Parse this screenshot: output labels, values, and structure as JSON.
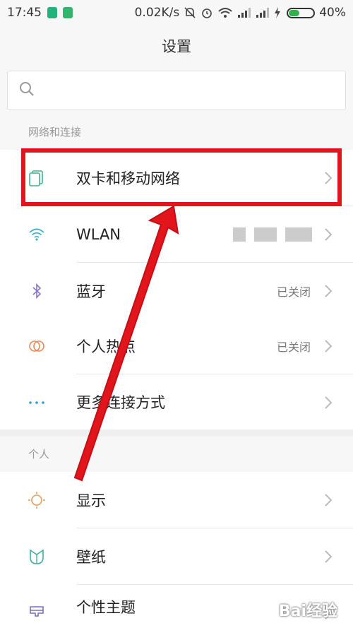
{
  "status_bar": {
    "time": "17:45",
    "network_speed": "0.02K/s",
    "battery_percent": "40%",
    "battery_level": 0.4,
    "icons": [
      "shield-badge-icon",
      "sim-badge-icon",
      "bell-muted-icon",
      "alarm-icon",
      "wifi-icon",
      "signal-1-icon",
      "signal-2-icon",
      "charging-icon",
      "battery-icon"
    ]
  },
  "header": {
    "title": "设置"
  },
  "search": {
    "icon": "search-icon",
    "placeholder": ""
  },
  "sections": {
    "network": {
      "title": "网络和连接"
    },
    "personal": {
      "title": "个人"
    }
  },
  "rows": {
    "dual_sim": {
      "label": "双卡和移动网络",
      "icon": "dual-sim-icon"
    },
    "wlan": {
      "label": "WLAN",
      "icon": "wifi-icon"
    },
    "bluetooth": {
      "label": "蓝牙",
      "status": "已关闭",
      "icon": "bluetooth-icon"
    },
    "hotspot": {
      "label": "个人热点",
      "status": "已关闭",
      "icon": "hotspot-icon"
    },
    "more": {
      "label": "更多连接方式",
      "icon": "more-dots-icon"
    },
    "display": {
      "label": "显示",
      "icon": "sun-icon"
    },
    "wallpaper": {
      "label": "壁纸",
      "icon": "wallpaper-icon"
    },
    "theme": {
      "label": "个性主题",
      "icon": "theme-brush-icon"
    }
  },
  "colors": {
    "highlight": "#e3151c",
    "accent_green": "#3fb38a",
    "bluetooth_purple": "#8b72c6",
    "hotspot_orange": "#e38a5a",
    "more_blue": "#2a9fd6",
    "sun_orange": "#e5a05a",
    "wallpaper_teal": "#3fb3a0",
    "theme_purple": "#7b6fc2"
  },
  "watermark": "Bai经验"
}
